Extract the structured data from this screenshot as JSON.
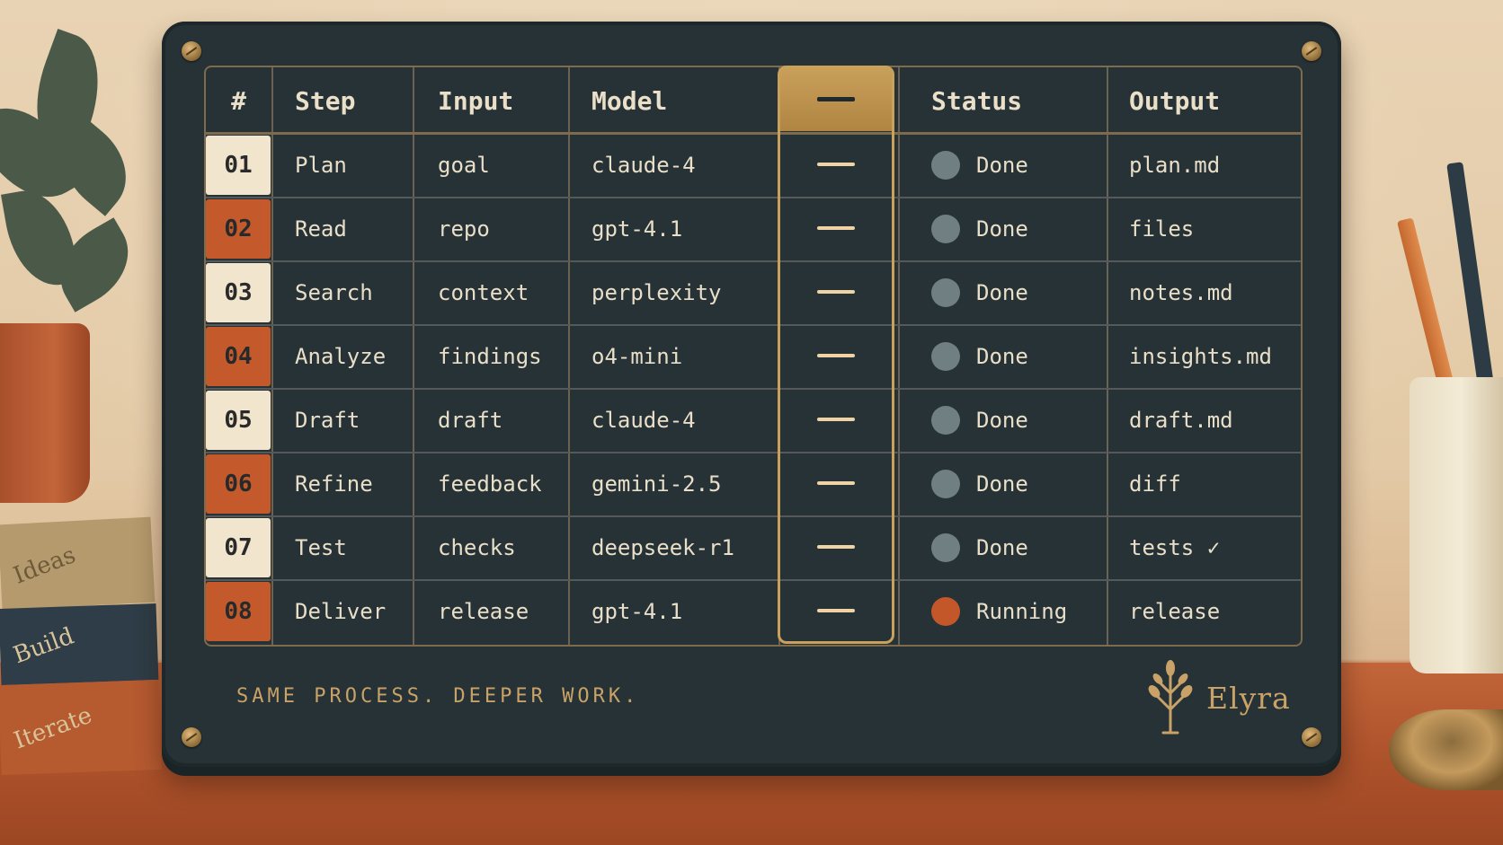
{
  "table": {
    "headers": {
      "num": "#",
      "step": "Step",
      "input": "Input",
      "model": "Model",
      "status": "Status",
      "output": "Output"
    },
    "rows": [
      {
        "num": "01",
        "step": "Plan",
        "input": "goal",
        "model": "claude-4",
        "status": "Done",
        "output": "plan.md"
      },
      {
        "num": "02",
        "step": "Read",
        "input": "repo",
        "model": "gpt-4.1",
        "status": "Done",
        "output": "files"
      },
      {
        "num": "03",
        "step": "Search",
        "input": "context",
        "model": "perplexity",
        "status": "Done",
        "output": "notes.md"
      },
      {
        "num": "04",
        "step": "Analyze",
        "input": "findings",
        "model": "o4-mini",
        "status": "Done",
        "output": "insights.md"
      },
      {
        "num": "05",
        "step": "Draft",
        "input": "draft",
        "model": "claude-4",
        "status": "Done",
        "output": "draft.md"
      },
      {
        "num": "06",
        "step": "Refine",
        "input": "feedback",
        "model": "gemini-2.5",
        "status": "Done",
        "output": "diff"
      },
      {
        "num": "07",
        "step": "Test",
        "input": "checks",
        "model": "deepseek-r1",
        "status": "Done",
        "output": "tests ✓"
      },
      {
        "num": "08",
        "step": "Deliver",
        "input": "release",
        "model": "gpt-4.1",
        "status": "Running",
        "output": "release"
      }
    ]
  },
  "footer": {
    "tagline": "SAME PROCESS. DEEPER WORK.",
    "brand": "Elyra",
    "brand_icon": "sprout-icon"
  },
  "books": [
    "Ideas",
    "Build",
    "Iterate"
  ],
  "colors": {
    "board": "#263236",
    "accent_gold": "#c9a15b",
    "accent_rust": "#c45a2c",
    "status_done": "#6f7f82",
    "status_running": "#c4572a"
  }
}
